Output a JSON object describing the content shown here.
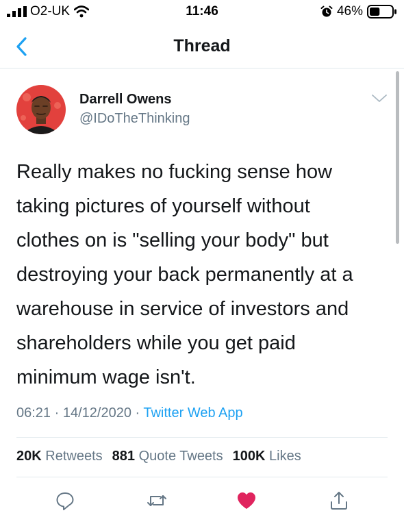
{
  "status_bar": {
    "carrier": "O2-UK",
    "time": "11:46",
    "battery_percent": "46%",
    "battery_level": 0.46,
    "icons": [
      "signal-icon",
      "wifi-icon",
      "alarm-icon",
      "battery-icon"
    ]
  },
  "nav": {
    "title": "Thread",
    "back_icon": "chevron-left-icon"
  },
  "tweet": {
    "author_name": "Darrell Owens",
    "author_handle": "@IDoTheThinking",
    "text": "Really makes no fucking sense how\ntaking pictures of yourself without\nclothes on is \"selling your body\" but\ndestroying your back permanently at a\nwarehouse in service of investors and\nshareholders while you get paid\nminimum wage isn't.",
    "time": "06:21",
    "separator": " · ",
    "date": "14/12/2020",
    "source": "Twitter Web App"
  },
  "stats": {
    "retweets_count": "20K",
    "retweets_label": "Retweets",
    "quote_tweets_count": "881",
    "quote_tweets_label": "Quote Tweets",
    "likes_count": "100K",
    "likes_label": "Likes"
  },
  "actions": {
    "icons": [
      "reply-icon",
      "retweet-icon",
      "like-icon",
      "share-icon"
    ],
    "liked": true
  },
  "colors": {
    "accent": "#1da1f2",
    "like": "#e0245e",
    "text": "#14171a",
    "secondary": "#657786",
    "border": "#e1e8ed"
  }
}
